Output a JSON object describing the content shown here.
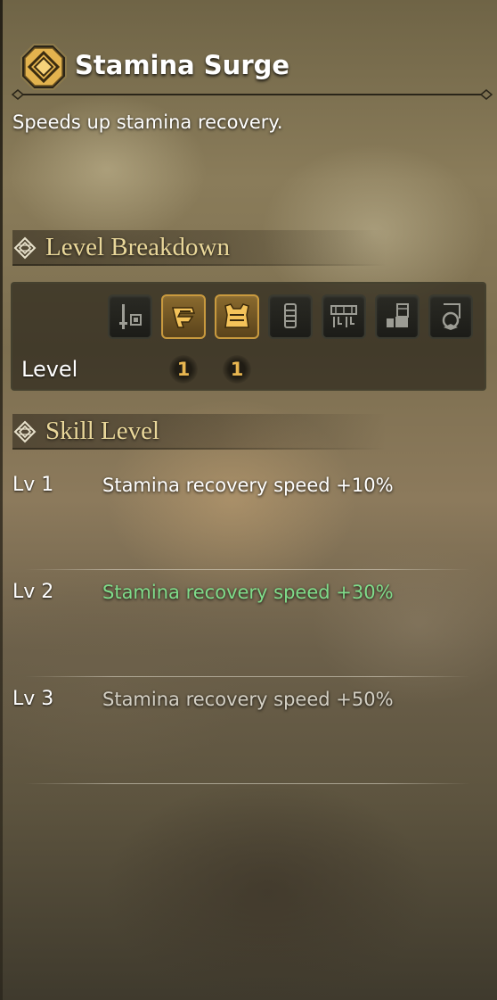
{
  "skill": {
    "title": "Stamina Surge",
    "description": "Speeds up stamina recovery.",
    "icon": "stamina-skill-icon",
    "accent_color": "#e0b04a"
  },
  "level_breakdown": {
    "heading": "Level Breakdown",
    "row_label": "Level",
    "slots": [
      {
        "icon": "weapon-icon",
        "active": false,
        "value": ""
      },
      {
        "icon": "helm-icon",
        "active": true,
        "value": "1"
      },
      {
        "icon": "chest-icon",
        "active": true,
        "value": "1"
      },
      {
        "icon": "arms-icon",
        "active": false,
        "value": ""
      },
      {
        "icon": "waist-icon",
        "active": false,
        "value": ""
      },
      {
        "icon": "legs-icon",
        "active": false,
        "value": ""
      },
      {
        "icon": "talisman-icon",
        "active": false,
        "value": ""
      }
    ],
    "active_color": "#c99a3e"
  },
  "skill_levels": {
    "heading": "Skill Level",
    "rows": [
      {
        "level": "Lv 1",
        "effect": "Stamina recovery speed +10%",
        "state": "normal"
      },
      {
        "level": "Lv 2",
        "effect": "Stamina recovery speed +30%",
        "state": "current"
      },
      {
        "level": "Lv 3",
        "effect": "Stamina recovery speed +50%",
        "state": "locked"
      }
    ],
    "current_color": "#7fdc8a"
  }
}
